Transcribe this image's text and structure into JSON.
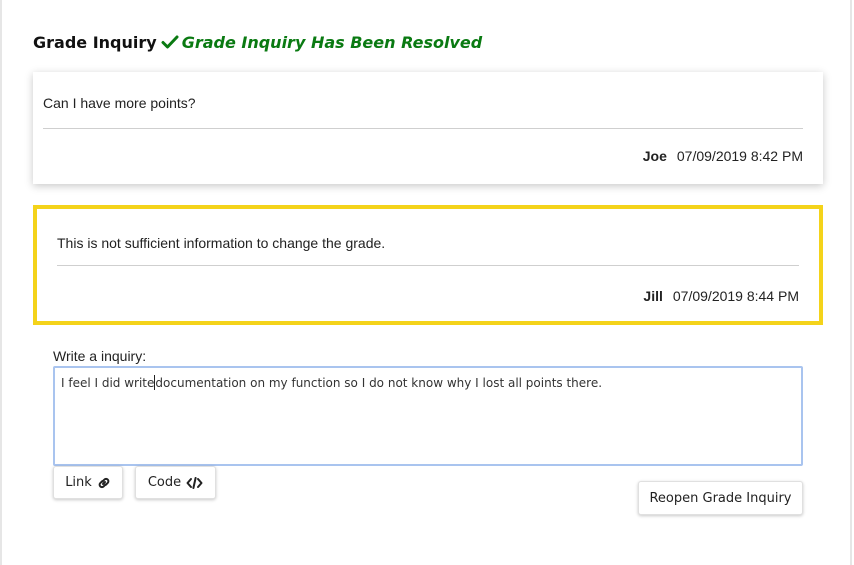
{
  "header": {
    "title": "Grade Inquiry",
    "status": "Grade Inquiry Has Been Resolved",
    "status_icon": "check-icon",
    "status_color": "#0a7a12"
  },
  "messages": [
    {
      "text": "Can  I have more points?",
      "author": "Joe",
      "timestamp": "07/09/2019 8:42 PM"
    },
    {
      "text": "This is not sufficient information to change the grade.",
      "author": "Jill",
      "timestamp": "07/09/2019 8:44 PM",
      "highlight_color": "#f4d31a"
    }
  ],
  "composer": {
    "label": "Write a inquiry:",
    "value_before_caret": "I feel I did write",
    "value_after_caret": "documentation on my function so I do not know why I lost all points there.",
    "link_label": "Link",
    "link_icon": "link-icon",
    "code_label": "Code",
    "code_icon": "code-icon",
    "reopen_label": "Reopen Grade Inquiry"
  }
}
